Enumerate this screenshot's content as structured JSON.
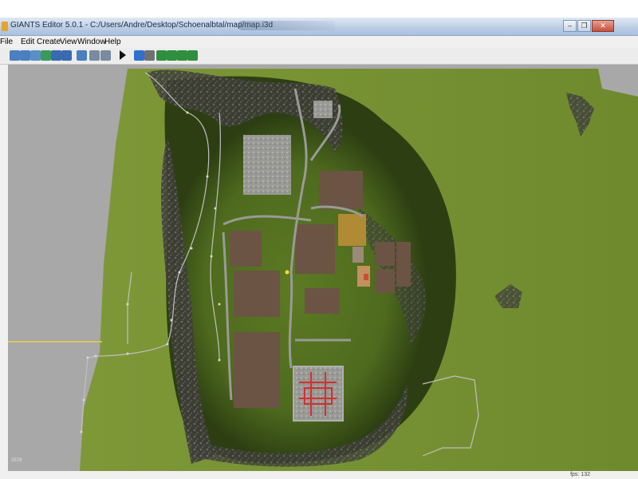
{
  "window": {
    "title": "GIANTS Editor 5.0.1 - C:/Users/Andre/Desktop/Schoenalbtal/map/map.i3d",
    "min_symbol": "–",
    "max_symbol": "❐",
    "close_symbol": "✕"
  },
  "menu": {
    "items": [
      "File",
      "Edit",
      "Create",
      "View",
      "Window",
      "Help"
    ]
  },
  "toolbar": {
    "buttons": [
      {
        "icon": "new-file-icon",
        "color": "#4a7fc0"
      },
      {
        "icon": "open-file-icon",
        "color": "#4a7fc0"
      },
      {
        "icon": "import-icon",
        "color": "#5a8fc8"
      },
      {
        "icon": "save-icon",
        "color": "#3a9a5a"
      },
      {
        "icon": "save-as-icon",
        "color": "#3a6ab0"
      },
      {
        "icon": "save-all-icon",
        "color": "#3a6ab0"
      },
      {
        "icon": "cut-icon",
        "color": "#4a7fc0"
      },
      {
        "icon": "undo-icon",
        "color": "#7a8aa0"
      },
      {
        "icon": "redo-icon",
        "color": "#7a8aa0"
      },
      {
        "icon": "play-icon",
        "color": "#111111"
      },
      {
        "icon": "select-tool-icon",
        "color": "#3070d0"
      },
      {
        "icon": "move-tool-icon",
        "color": "#707070"
      },
      {
        "icon": "terrain-sculpt-icon",
        "color": "#2f8f3f"
      },
      {
        "icon": "terrain-paint-icon",
        "color": "#2f8f3f"
      },
      {
        "icon": "foliage-paint-icon",
        "color": "#2f8f3f"
      },
      {
        "icon": "foliage-erase-icon",
        "color": "#2f8f3f"
      }
    ]
  },
  "viewport": {
    "coordinate_readout": "2578",
    "status_right": "fps: 132"
  },
  "colors": {
    "grass": "#6f8a2c",
    "field": "#6b5443",
    "gravel": "#8c8c8c",
    "rock": "#3a3a35",
    "spline": "#b8b8b8",
    "wheat": "#b08a35",
    "yard_marker": "#d23030"
  }
}
